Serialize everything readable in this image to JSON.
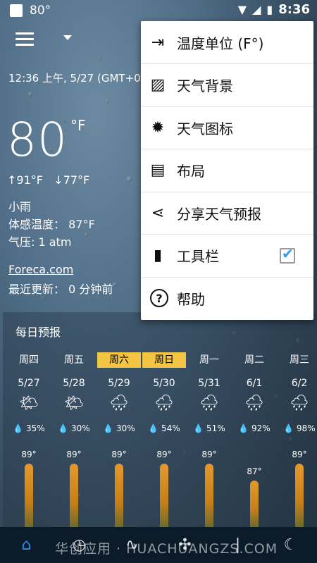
{
  "status_bar": {
    "temp": "80°",
    "time": "8:36"
  },
  "header": {
    "timestamp": "12:36 上午, 5/27 (GMT+0"
  },
  "current": {
    "temp": "80",
    "unit": "°F",
    "high": "↑91°F",
    "low": "↓77°F",
    "condition": "小雨",
    "feels_like": "体感温度： 87°F",
    "pressure": "气压: 1 atm",
    "source_link": "Foreca.com",
    "updated": "最近更新： 0 分钟前"
  },
  "forecast": {
    "title": "每日预报",
    "days": [
      {
        "label": "周四",
        "date": "5/27",
        "precip": "💧 35%",
        "high": "89°",
        "icon": "partly-sunny-icon",
        "glyph": "🌤",
        "highlight": false
      },
      {
        "label": "周五",
        "date": "5/28",
        "precip": "💧 30%",
        "high": "89°",
        "icon": "partly-sunny-icon",
        "glyph": "🌤",
        "highlight": false
      },
      {
        "label": "周六",
        "date": "5/29",
        "precip": "💧 30%",
        "high": "89°",
        "icon": "rain-cloud-icon",
        "glyph": "🌧",
        "highlight": true
      },
      {
        "label": "周日",
        "date": "5/30",
        "precip": "💧 54%",
        "high": "89°",
        "icon": "rain-cloud-icon",
        "glyph": "🌧",
        "highlight": true
      },
      {
        "label": "周一",
        "date": "5/31",
        "precip": "💧 51%",
        "high": "89°",
        "icon": "rain-cloud-icon",
        "glyph": "🌧",
        "highlight": false
      },
      {
        "label": "周二",
        "date": "6/1",
        "precip": "💧 92%",
        "high": "87°",
        "icon": "rain-cloud-icon",
        "glyph": "🌧",
        "highlight": false
      },
      {
        "label": "周三",
        "date": "6/2",
        "precip": "💧 98%",
        "high": "89°",
        "icon": "rain-cloud-icon",
        "glyph": "🌧",
        "highlight": false
      }
    ]
  },
  "menu": {
    "items": [
      {
        "label": "温度单位 (F°)",
        "icon": "temperature-unit-icon"
      },
      {
        "label": "天气背景",
        "icon": "weather-background-icon"
      },
      {
        "label": "天气图标",
        "icon": "weather-icons-icon"
      },
      {
        "label": "布局",
        "icon": "layout-icon"
      },
      {
        "label": "分享天气预报",
        "icon": "share-icon"
      },
      {
        "label": "工具栏",
        "icon": "toolbar-icon",
        "checked": true
      },
      {
        "label": "帮助",
        "icon": "help-icon"
      }
    ]
  },
  "watermark": "华创应用 · HUACHUANGZS.COM",
  "colors": {
    "accent": "#2f8fe8",
    "highlight": "#f4c542",
    "bar": "#e39a2c"
  }
}
